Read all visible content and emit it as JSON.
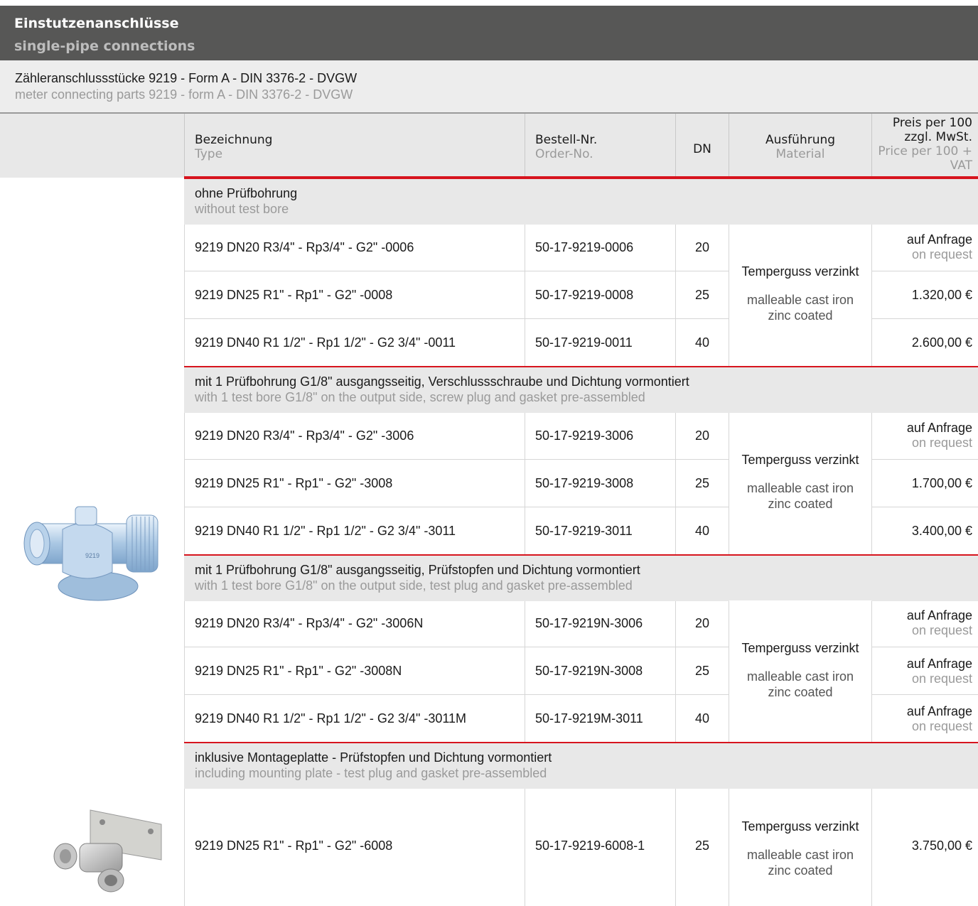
{
  "header": {
    "title_de": "Einstutzenanschlüsse",
    "title_en": "single-pipe connections"
  },
  "product": {
    "title_de": "Zähleranschlussstücke 9219 - Form A - DIN 3376-2 - DVGW",
    "title_en": "meter connecting parts 9219 - form A - DIN 3376-2 - DVGW"
  },
  "columns": {
    "type_de": "Bezeichnung",
    "type_en": "Type",
    "order_de": "Bestell-Nr.",
    "order_en": "Order-No.",
    "dn": "DN",
    "material_de": "Ausführung",
    "material_en": "Material",
    "price_de": "Preis per 100 zzgl. MwSt.",
    "price_en": "Price per 100 + VAT"
  },
  "material": {
    "de": "Temperguss verzinkt",
    "en_line1": "malleable cast iron",
    "en_line2": "zinc coated"
  },
  "request": {
    "de": "auf Anfrage",
    "en": "on request"
  },
  "groups": [
    {
      "title_de": "ohne Prüfbohrung",
      "title_en": "without test bore",
      "rows": [
        {
          "type": "9219 DN20 R3/4\" - Rp3/4\" - G2\" -0006",
          "order": "50-17-9219-0006",
          "dn": "20",
          "price": ""
        },
        {
          "type": "9219 DN25 R1\" - Rp1\" - G2\" -0008",
          "order": "50-17-9219-0008",
          "dn": "25",
          "price": "1.320,00 €"
        },
        {
          "type": "9219 DN40 R1 1/2\" - Rp1 1/2\" - G2 3/4\" -0011",
          "order": "50-17-9219-0011",
          "dn": "40",
          "price": "2.600,00 €"
        }
      ]
    },
    {
      "title_de": "mit 1 Prüfbohrung G1/8\" ausgangsseitig, Verschlussschraube und Dichtung vormontiert",
      "title_en": "with 1 test bore G1/8\" on the output side, screw plug and gasket pre-assembled",
      "rows": [
        {
          "type": "9219 DN20 R3/4\" - Rp3/4\" - G2\" -3006",
          "order": "50-17-9219-3006",
          "dn": "20",
          "price": ""
        },
        {
          "type": "9219 DN25 R1\" - Rp1\" - G2\" -3008",
          "order": "50-17-9219-3008",
          "dn": "25",
          "price": "1.700,00 €"
        },
        {
          "type": "9219 DN40 R1 1/2\" - Rp1 1/2\" - G2 3/4\" -3011",
          "order": "50-17-9219-3011",
          "dn": "40",
          "price": "3.400,00 €"
        }
      ]
    },
    {
      "title_de": "mit 1 Prüfbohrung G1/8\" ausgangsseitig, Prüfstopfen und Dichtung vormontiert",
      "title_en": "with 1 test bore G1/8\" on the output side, test plug and gasket pre-assembled",
      "rows": [
        {
          "type": "9219 DN20 R3/4\" - Rp3/4\" - G2\" -3006N",
          "order": "50-17-9219N-3006",
          "dn": "20",
          "price": ""
        },
        {
          "type": "9219 DN25 R1\" - Rp1\" - G2\" -3008N",
          "order": "50-17-9219N-3008",
          "dn": "25",
          "price": ""
        },
        {
          "type": "9219 DN40 R1 1/2\" - Rp1 1/2\" - G2 3/4\" -3011M",
          "order": "50-17-9219M-3011",
          "dn": "40",
          "price": ""
        }
      ]
    },
    {
      "title_de": "inklusive Montageplatte - Prüfstopfen und Dichtung vormontiert",
      "title_en": "including mounting plate - test plug and gasket pre-assembled",
      "rows": [
        {
          "type": "9219 DN25 R1\" - Rp1\" - G2\" -6008",
          "order": "50-17-9219-6008-1",
          "dn": "25",
          "price": "3.750,00 €"
        }
      ]
    }
  ]
}
